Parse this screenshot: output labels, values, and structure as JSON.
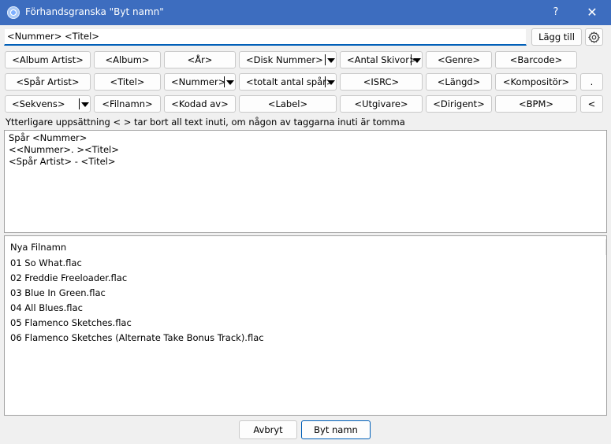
{
  "window": {
    "title": "Förhandsgranska \"Byt namn\"",
    "help_label": "?",
    "close_label": "✕"
  },
  "pattern": {
    "value": "<Nummer> <Titel>"
  },
  "toolbar": {
    "add_label": "Lägg till",
    "settings_icon": "gear-icon"
  },
  "tags": {
    "row1": [
      "<Album Artist>",
      "<Album>",
      "<År>",
      "<Disk Nummer>",
      "<Antal Skivor>",
      "<Genre>",
      "<Barcode>"
    ],
    "row2": [
      "<Spår Artist>",
      "<Titel>",
      "<Nummer>",
      "<totalt antal spår>",
      "<ISRC>",
      "<Längd>",
      "<Kompositör>",
      "."
    ],
    "row3": [
      "<Sekvens>",
      "<Filnamn>",
      "<Kodad av>",
      "<Label>",
      "<Utgivare>",
      "<Dirigent>",
      "<BPM>",
      "<"
    ]
  },
  "hint": "Ytterligare uppsättning < > tar bort all text inuti, om någon av taggarna inuti är tomma",
  "templates": [
    "Spår <Nummer>",
    "<<Nummer>. ><Titel>",
    "<Spår Artist> - <Titel>"
  ],
  "files": {
    "header": "Nya Filnamn",
    "items": [
      "01 So What.flac",
      "02 Freddie Freeloader.flac",
      "03 Blue In Green.flac",
      "04 All Blues.flac",
      "05 Flamenco Sketches.flac",
      "06 Flamenco Sketches (Alternate Take Bonus Track).flac"
    ]
  },
  "footer": {
    "cancel_label": "Avbryt",
    "rename_label": "Byt namn"
  },
  "colors": {
    "titlebar": "#3d6dbf",
    "accent": "#005fb8",
    "background": "#f0f0f0"
  }
}
